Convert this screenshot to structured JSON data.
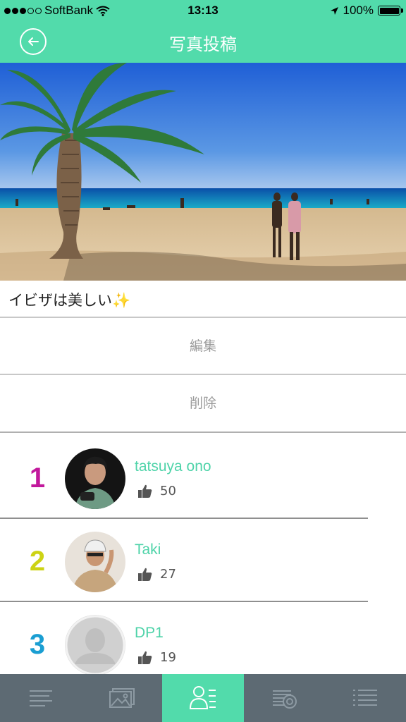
{
  "status_bar": {
    "carrier": "SoftBank",
    "time": "13:13",
    "battery": "100%"
  },
  "header": {
    "title": "写真投稿"
  },
  "post": {
    "caption": "イビザは美しい✨"
  },
  "actions": {
    "edit_label": "編集",
    "delete_label": "削除"
  },
  "ranking": [
    {
      "rank": "1",
      "rank_color": "#c2189c",
      "name": "tatsuya ono",
      "likes": "50"
    },
    {
      "rank": "2",
      "rank_color": "#cdd315",
      "name": "Taki",
      "likes": "27"
    },
    {
      "rank": "3",
      "rank_color": "#1a9ed2",
      "name": "DP1",
      "likes": "19"
    }
  ],
  "tabs": [
    {
      "icon": "menu-lines-icon",
      "active": false
    },
    {
      "icon": "gallery-icon",
      "active": false
    },
    {
      "icon": "profile-list-icon",
      "active": true
    },
    {
      "icon": "camera-stack-icon",
      "active": false
    },
    {
      "icon": "list-icon",
      "active": false
    }
  ],
  "colors": {
    "accent": "#52dbab",
    "username": "#4fd3a9",
    "tabbar": "#5d6a73"
  }
}
